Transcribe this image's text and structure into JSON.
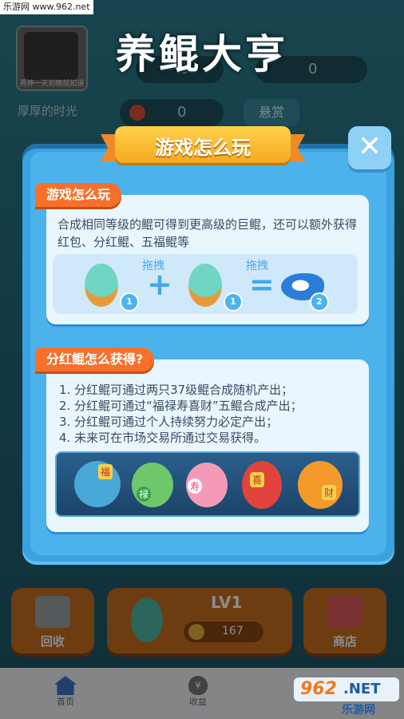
{
  "watermark_top": "乐游网 www.962.net",
  "game_title": "养鲲大亨",
  "hud": {
    "avatar_caption": "男神一天到晚就知道",
    "nickname": "厚厚的时光",
    "value_1": "0",
    "value_2": "0",
    "value_3": "0",
    "reward_button": "悬赏"
  },
  "modal": {
    "title": "游戏怎么玩",
    "close_label": "✕",
    "section1": {
      "tag": "游戏怎么玩",
      "description": "合成相同等级的鲲可得到更高级的巨鲲，还可以额外获得红包、分红鲲、五福鲲等",
      "drag_1": "拖拽",
      "drag_2": "拖拽",
      "plus": "+",
      "equals": "=",
      "level_a": "1",
      "level_b": "1",
      "level_c": "2"
    },
    "section2": {
      "tag": "分红鲲怎么获得?",
      "items": [
        "1. 分红鲲可通过两只37级鲲合成随机产出；",
        "2. 分红鲲可通过“福禄寿喜财”五鲲合成产出；",
        "3. 分红鲲可通过个人持续努力必定产出；",
        "4. 未来可在市场交易所通过交易获得。"
      ],
      "fish_labels": [
        "福",
        "禄",
        "寿",
        "喜",
        "财"
      ]
    }
  },
  "bottom": {
    "recycle_label": "回收",
    "level_label": "LV1",
    "coin_value": "167",
    "shop_label": "商店"
  },
  "nav": {
    "home": "首页",
    "earnings": "收益"
  },
  "watermark_bottom": {
    "brand": "962",
    "suffix": ".NET",
    "sub": "乐游网"
  },
  "colors": {
    "modal_blue": "#3aa2e0",
    "tag_orange": "#f6702c",
    "banner_yellow": "#ffd04a",
    "text_dark": "#3a4a63"
  }
}
